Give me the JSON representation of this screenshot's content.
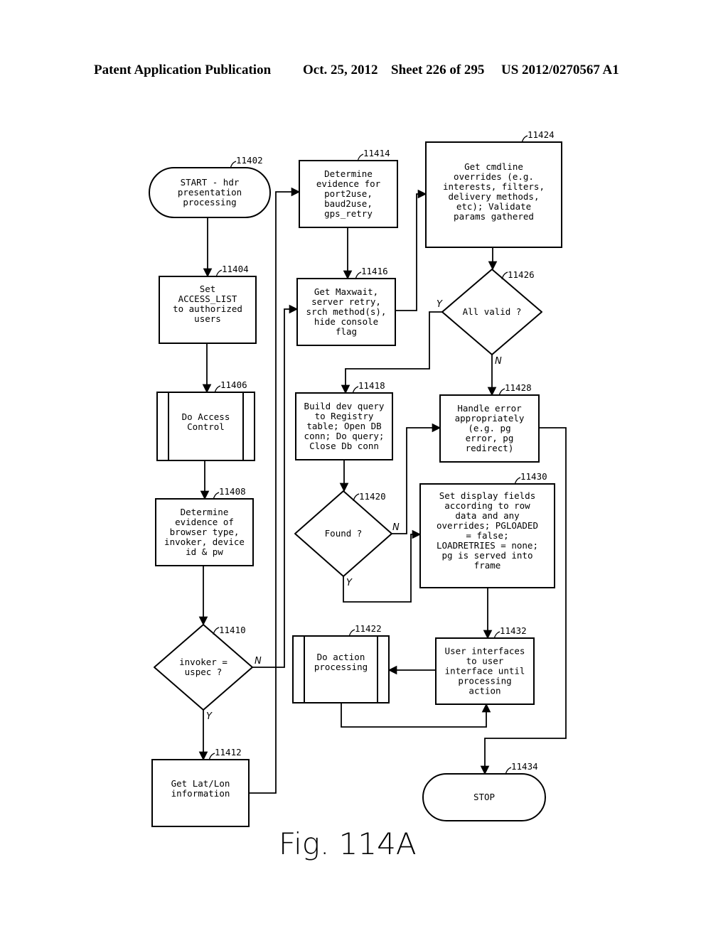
{
  "header": {
    "publication": "Patent Application Publication",
    "date": "Oct. 25, 2012",
    "sheet": "Sheet 226 of 295",
    "patent_number": "US 2012/0270567 A1"
  },
  "figure_label": "Fig. 114A",
  "nodes": [
    {
      "id": "11402",
      "type": "terminator",
      "lines": [
        "START - hdr",
        "presentation",
        "processing"
      ]
    },
    {
      "id": "11404",
      "type": "process",
      "lines": [
        "Set",
        "ACCESS_LIST",
        "to authorized",
        "users"
      ]
    },
    {
      "id": "11406",
      "type": "predefined-process",
      "lines": [
        "Do Access",
        "Control"
      ]
    },
    {
      "id": "11408",
      "type": "process",
      "lines": [
        "Determine",
        "evidence of",
        "browser type,",
        "invoker, device",
        "id & pw"
      ]
    },
    {
      "id": "11410",
      "type": "decision",
      "lines": [
        "invoker =",
        "uspec ?"
      ]
    },
    {
      "id": "11412",
      "type": "process",
      "lines": [
        "Get Lat/Lon",
        "information"
      ]
    },
    {
      "id": "11414",
      "type": "process",
      "lines": [
        "Determine",
        "evidence for",
        "port2use,",
        "baud2use,",
        "gps_retry"
      ]
    },
    {
      "id": "11416",
      "type": "process",
      "lines": [
        "Get Maxwait,",
        "server retry,",
        "srch method(s),",
        "hide console",
        "flag"
      ]
    },
    {
      "id": "11418",
      "type": "process",
      "lines": [
        "Build dev query",
        "to Registry",
        "table; Open DB",
        "conn; Do query;",
        "Close Db conn"
      ]
    },
    {
      "id": "11420",
      "type": "decision",
      "lines": [
        "Found ?"
      ]
    },
    {
      "id": "11422",
      "type": "predefined-process",
      "lines": [
        "Do action",
        "processing"
      ]
    },
    {
      "id": "11424",
      "type": "process",
      "lines": [
        "Get cmdline",
        "overrides (e.g.",
        "interests, filters,",
        "delivery methods,",
        "etc); Validate",
        "params gathered"
      ]
    },
    {
      "id": "11426",
      "type": "decision",
      "lines": [
        "All valid ?"
      ]
    },
    {
      "id": "11428",
      "type": "process",
      "lines": [
        "Handle error",
        "appropriately",
        "(e.g. pg",
        "error, pg",
        "redirect)"
      ]
    },
    {
      "id": "11430",
      "type": "process",
      "lines": [
        "Set display fields",
        "according to row",
        "data and any",
        "overrides; PGLOADED",
        "= false;",
        "LOADRETRIES = none;",
        "pg is served into",
        "frame"
      ]
    },
    {
      "id": "11432",
      "type": "process",
      "lines": [
        "User interfaces",
        "to user",
        "interface until",
        "processing",
        "action"
      ]
    },
    {
      "id": "11434",
      "type": "terminator",
      "lines": [
        "STOP"
      ]
    }
  ],
  "edges": [
    {
      "from": "11402",
      "to": "11404",
      "label": ""
    },
    {
      "from": "11404",
      "to": "11406",
      "label": ""
    },
    {
      "from": "11406",
      "to": "11408",
      "label": ""
    },
    {
      "from": "11408",
      "to": "11410",
      "label": ""
    },
    {
      "from": "11410",
      "to": "11412",
      "label": "Y"
    },
    {
      "from": "11410",
      "to": "11416",
      "label": "N"
    },
    {
      "from": "11412",
      "to": "11414",
      "label": ""
    },
    {
      "from": "11414",
      "to": "11416",
      "label": ""
    },
    {
      "from": "11416",
      "to": "11424",
      "label": ""
    },
    {
      "from": "11424",
      "to": "11426",
      "label": ""
    },
    {
      "from": "11426",
      "to": "11418",
      "label": "Y"
    },
    {
      "from": "11426",
      "to": "11428",
      "label": "N"
    },
    {
      "from": "11418",
      "to": "11420",
      "label": ""
    },
    {
      "from": "11420",
      "to": "11428",
      "label": "N"
    },
    {
      "from": "11420",
      "to": "11430",
      "label": "Y"
    },
    {
      "from": "11430",
      "to": "11432",
      "label": ""
    },
    {
      "from": "11432",
      "to": "11422",
      "label": ""
    },
    {
      "from": "11422",
      "to": "11432",
      "label": ""
    },
    {
      "from": "11428",
      "to": "11434",
      "label": ""
    }
  ]
}
